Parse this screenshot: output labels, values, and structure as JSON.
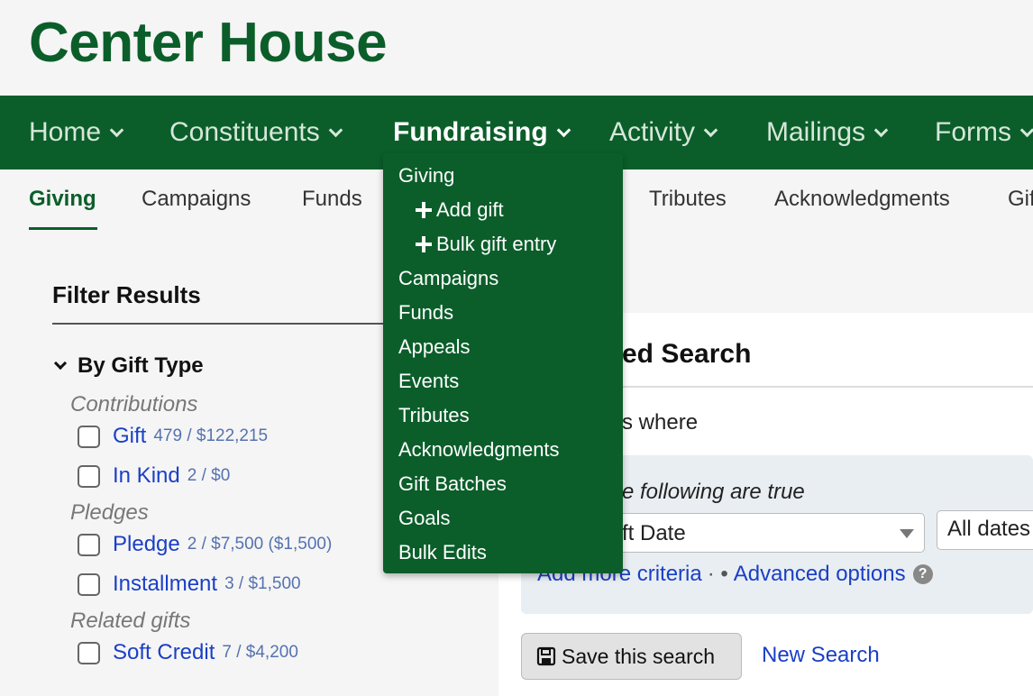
{
  "brand": {
    "title": "Center House"
  },
  "topnav": {
    "items": [
      {
        "label": "Home"
      },
      {
        "label": "Constituents"
      },
      {
        "label": "Fundraising"
      },
      {
        "label": "Activity"
      },
      {
        "label": "Mailings"
      },
      {
        "label": "Forms"
      }
    ],
    "active": "Fundraising"
  },
  "subnav": {
    "items": [
      {
        "label": "Giving"
      },
      {
        "label": "Campaigns"
      },
      {
        "label": "Funds"
      },
      {
        "label": "Tributes"
      },
      {
        "label": "Acknowledgments"
      },
      {
        "label": "Gift"
      }
    ],
    "active": "Giving"
  },
  "dropdown": {
    "items": [
      {
        "label": "Giving"
      },
      {
        "label": "Add gift",
        "icon": "plus-icon"
      },
      {
        "label": "Bulk gift entry",
        "icon": "plus-icon"
      },
      {
        "label": "Campaigns"
      },
      {
        "label": "Funds"
      },
      {
        "label": "Appeals"
      },
      {
        "label": "Events"
      },
      {
        "label": "Tributes"
      },
      {
        "label": "Acknowledgments"
      },
      {
        "label": "Gift Batches"
      },
      {
        "label": "Goals"
      },
      {
        "label": "Bulk Edits"
      }
    ]
  },
  "filters": {
    "title": "Filter Results",
    "group": "By Gift Type",
    "categories": [
      {
        "label": "Contributions"
      },
      {
        "label": "Pledges"
      },
      {
        "label": "Related gifts"
      }
    ],
    "options": [
      {
        "label": "Gift",
        "count": "479 / $122,215"
      },
      {
        "label": "In Kind",
        "count": "2 / $0"
      },
      {
        "label": "Pledge",
        "count": "2 / $7,500 ($1,500)"
      },
      {
        "label": "Installment",
        "count": "3 / $1,500"
      },
      {
        "label": "Soft Credit",
        "count": "7 / $4,200"
      }
    ]
  },
  "search": {
    "title": "ed Search",
    "where": "s where",
    "following": "e following are true",
    "field_value": "ft Date",
    "dates_value": "All dates",
    "add_more": "Add more criteria",
    "separator": "· •",
    "advanced": "Advanced options",
    "help_icon": "?",
    "save_label": "Save this search",
    "new_search": "New Search"
  },
  "colors": {
    "brand_green": "#0b5e2a",
    "link_blue": "#1a3fc6"
  }
}
